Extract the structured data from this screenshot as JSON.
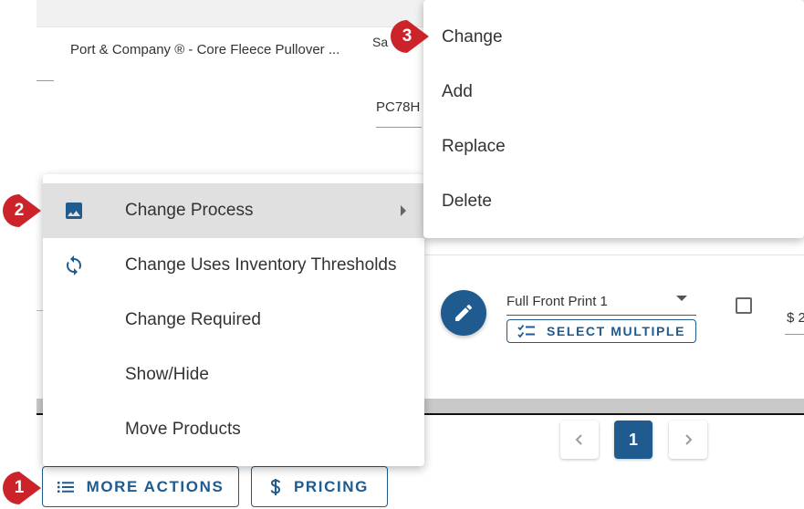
{
  "background": {
    "product_name": "Port & Company ® - Core Fleece Pullover ...",
    "size_label": "Sa",
    "sku": "PC78H",
    "process_select_value": "Full Front Print 1",
    "select_multiple_label": "SELECT MULTIPLE",
    "price_prefix": "$ 2"
  },
  "pagination": {
    "prev_icon": "chevron-left-icon",
    "current_page": "1",
    "next_icon": "chevron-right-icon"
  },
  "toolbar": {
    "more_actions_label": "MORE ACTIONS",
    "pricing_label": "PRICING"
  },
  "context_menu": {
    "items": [
      {
        "label": "Change Process",
        "icon": "image-icon",
        "has_submenu": true,
        "highlighted": true
      },
      {
        "label": "Change Uses Inventory Thresholds",
        "icon": "sync-icon"
      },
      {
        "label": "Change Required"
      },
      {
        "label": "Show/Hide"
      },
      {
        "label": "Move Products"
      }
    ]
  },
  "submenu": {
    "items": [
      {
        "label": "Change"
      },
      {
        "label": "Add"
      },
      {
        "label": "Replace"
      },
      {
        "label": "Delete"
      }
    ]
  },
  "callouts": [
    "1",
    "2",
    "3"
  ],
  "colors": {
    "primary": "#1f5b8e",
    "badge_red": "#cc2229",
    "menu_highlight": "#e0e0e0"
  }
}
